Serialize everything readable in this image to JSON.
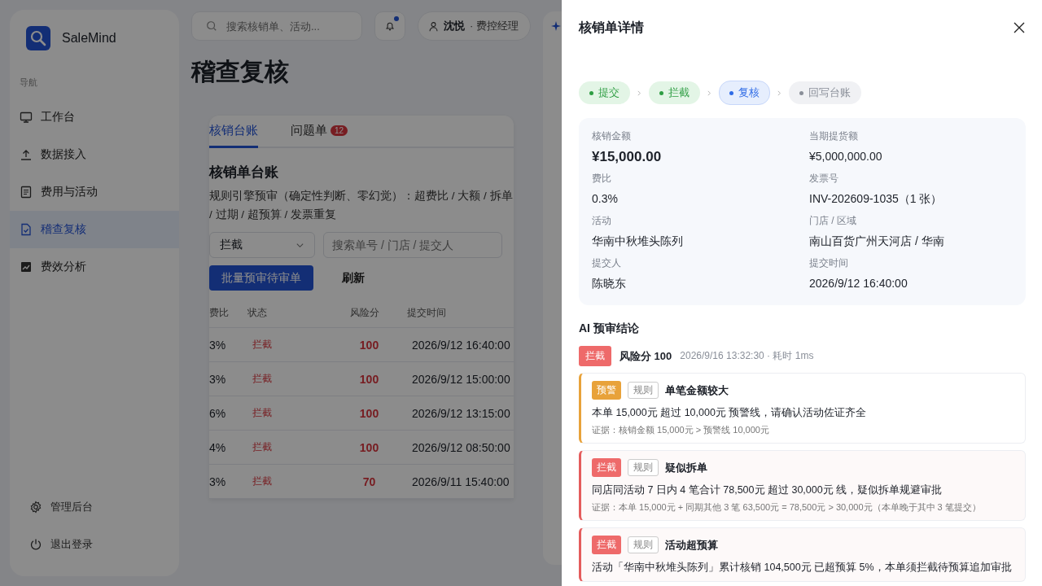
{
  "sidebar": {
    "brand": "SaleMind",
    "nav_label": "导航",
    "items": [
      {
        "label": "工作台",
        "selected": false
      },
      {
        "label": "数据接入",
        "selected": false
      },
      {
        "label": "费用与活动",
        "selected": false
      },
      {
        "label": "稽查复核",
        "selected": true
      },
      {
        "label": "费效分析",
        "selected": false
      }
    ],
    "footer_items": [
      {
        "label": "管理后台"
      },
      {
        "label": "退出登录"
      }
    ]
  },
  "topbar": {
    "search_placeholder": "搜索核销单、活动...",
    "notification_unread": true,
    "user_name": "沈悦",
    "user_role": "· 费控经理"
  },
  "page_title": "稽查复核",
  "tabs": [
    {
      "label": "核销台账",
      "selected": true
    },
    {
      "label": "问题单",
      "selected": false,
      "badge": "12"
    }
  ],
  "ledger": {
    "title": "核销单台账",
    "description": "规则引擎预审（确定性判断、零幻觉）：超费比 / 大额 / 拆单 / 过期 / 超预算 / 发票重复",
    "filter_value": "拦截",
    "search_placeholder": "搜索单号 / 门店 / 提交人",
    "buttons": [
      {
        "label": "批量预审待审单",
        "kind": "primary"
      },
      {
        "label": "刷新",
        "kind": "text"
      }
    ],
    "columns": [
      "费比",
      "状态",
      "风险分",
      "提交时间"
    ],
    "rows": [
      {
        "ratio": "3%",
        "status": "拦截",
        "score": "100",
        "time": "2026/9/12 16:40:00"
      },
      {
        "ratio": "3%",
        "status": "拦截",
        "score": "100",
        "time": "2026/9/12 15:00:00"
      },
      {
        "ratio": "6%",
        "status": "拦截",
        "score": "100",
        "time": "2026/9/12 13:15:00"
      },
      {
        "ratio": "4%",
        "status": "拦截",
        "score": "100",
        "time": "2026/9/12 08:50:00"
      },
      {
        "ratio": "3%",
        "status": "拦截",
        "score": "70",
        "time": "2026/9/11 15:40:00"
      }
    ]
  },
  "drawer": {
    "title": "核销单详情",
    "steps": [
      {
        "label": "提交",
        "done": true,
        "selected": false
      },
      {
        "label": "拦截",
        "done": true,
        "selected": false
      },
      {
        "label": "复核",
        "done": false,
        "selected": true
      },
      {
        "label": "回写台账",
        "done": false,
        "selected": false
      }
    ],
    "fields": [
      {
        "label": "核销金额",
        "value": "¥15,000.00",
        "emphasis": true
      },
      {
        "label": "当期提货额",
        "value": "¥5,000,000.00",
        "emphasis": false
      },
      {
        "label": "费比",
        "value": "0.3%",
        "emphasis": false
      },
      {
        "label": "发票号",
        "value": "INV-202609-1035（1 张）",
        "emphasis": false
      },
      {
        "label": "活动",
        "value": "华南中秋堆头陈列",
        "emphasis": false
      },
      {
        "label": "门店 / 区域",
        "value": "南山百货广州天河店 / 华南",
        "emphasis": false
      },
      {
        "label": "提交人",
        "value": "陈晓东",
        "emphasis": false
      },
      {
        "label": "提交时间",
        "value": "2026/9/12 16:40:00",
        "emphasis": false
      }
    ],
    "ai_title": "AI 预审结论",
    "verdict": {
      "tag": "拦截",
      "kind": "block",
      "score": "风险分 100",
      "meta": "2026/9/16 13:32:30 · 耗时 1ms"
    },
    "rules": [
      {
        "kind": "warn",
        "tag": "预警",
        "source": "规则",
        "title": "单笔金额较大",
        "message": "本单 15,000元 超过 10,000元 预警线，请确认活动佐证齐全",
        "evidence": "证据：核销金额 15,000元 > 预警线 10,000元"
      },
      {
        "kind": "block",
        "tag": "拦截",
        "source": "规则",
        "title": "疑似拆单",
        "message": "同店同活动 7 日内 4 笔合计 78,500元 超过 30,000元 线，疑似拆单规避审批",
        "evidence": "证据：本单 15,000元 + 同期其他 3 笔 63,500元 = 78,500元 > 30,000元（本单晚于其中 3 笔提交）"
      },
      {
        "kind": "block",
        "tag": "拦截",
        "source": "规则",
        "title": "活动超预算",
        "message": "活动「华南中秋堆头陈列」累计核销 104,500元 已超预算 5%，本单须拦截待预算追加审批"
      }
    ]
  }
}
